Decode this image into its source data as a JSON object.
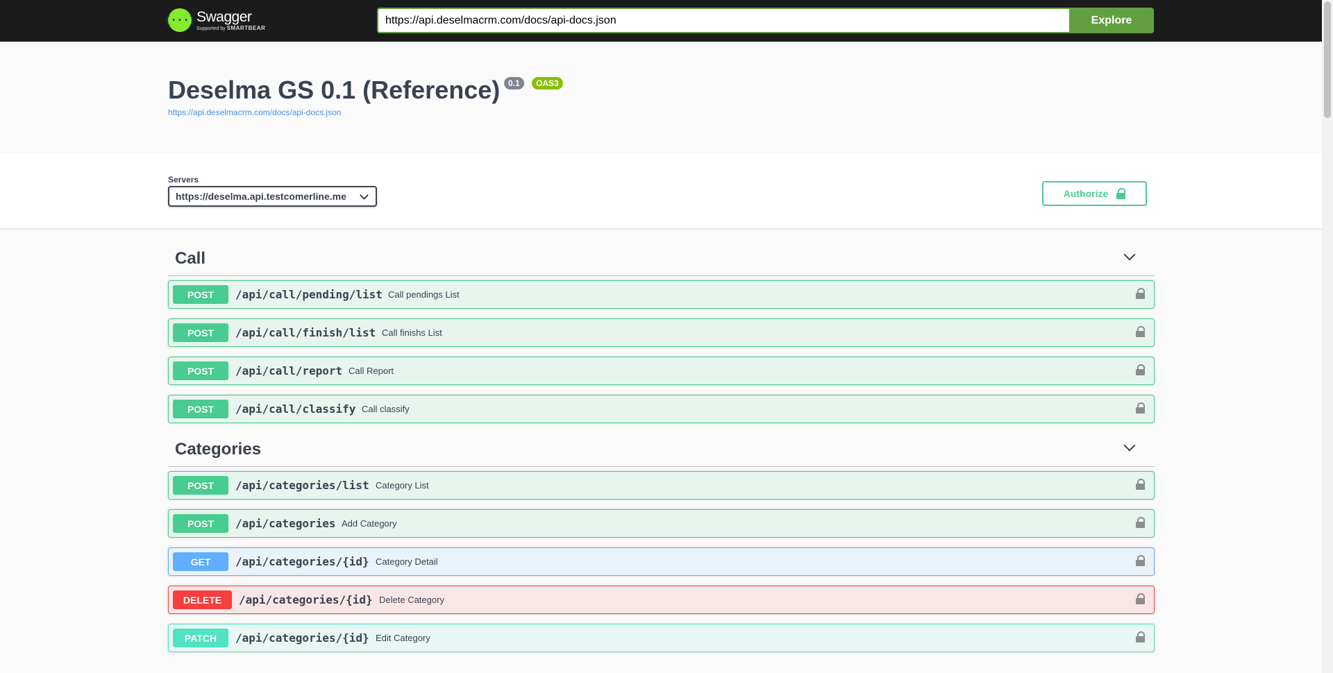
{
  "topbar": {
    "logo_icon": "{···}",
    "logo_name": "Swagger",
    "logo_supported_by": "Supported by",
    "logo_smartbear": "SMARTBEAR",
    "url_value": "https://api.deselmacrm.com/docs/api-docs.json",
    "explore_label": "Explore"
  },
  "info": {
    "title": "Deselma GS 0.1 (Reference)",
    "version_badge": "0.1",
    "oas_badge": "OAS3",
    "spec_link": "https://api.deselmacrm.com/docs/api-docs.json"
  },
  "scheme": {
    "servers_label": "Servers",
    "server_selected": "https://deselma.api.testcomerline.me",
    "authorize_label": "Authorize",
    "authorize_icon": "lock-icon"
  },
  "tags": [
    {
      "name": "Call",
      "operations": [
        {
          "method": "POST",
          "path": "/api/call/pending/list",
          "summary": "Call pendings List"
        },
        {
          "method": "POST",
          "path": "/api/call/finish/list",
          "summary": "Call finishs List"
        },
        {
          "method": "POST",
          "path": "/api/call/report",
          "summary": "Call Report"
        },
        {
          "method": "POST",
          "path": "/api/call/classify",
          "summary": "Call classify"
        }
      ]
    },
    {
      "name": "Categories",
      "operations": [
        {
          "method": "POST",
          "path": "/api/categories/list",
          "summary": "Category List"
        },
        {
          "method": "POST",
          "path": "/api/categories",
          "summary": "Add Category"
        },
        {
          "method": "GET",
          "path": "/api/categories/{id}",
          "summary": "Category Detail"
        },
        {
          "method": "DELETE",
          "path": "/api/categories/{id}",
          "summary": "Delete Category"
        },
        {
          "method": "PATCH",
          "path": "/api/categories/{id}",
          "summary": "Edit Category"
        }
      ]
    }
  ],
  "colors": {
    "post": "#49cc90",
    "get": "#61affe",
    "delete": "#f93e3e",
    "patch": "#50e3c2",
    "topbar_bg": "#1b1b1b",
    "explore": "#62a03f"
  }
}
